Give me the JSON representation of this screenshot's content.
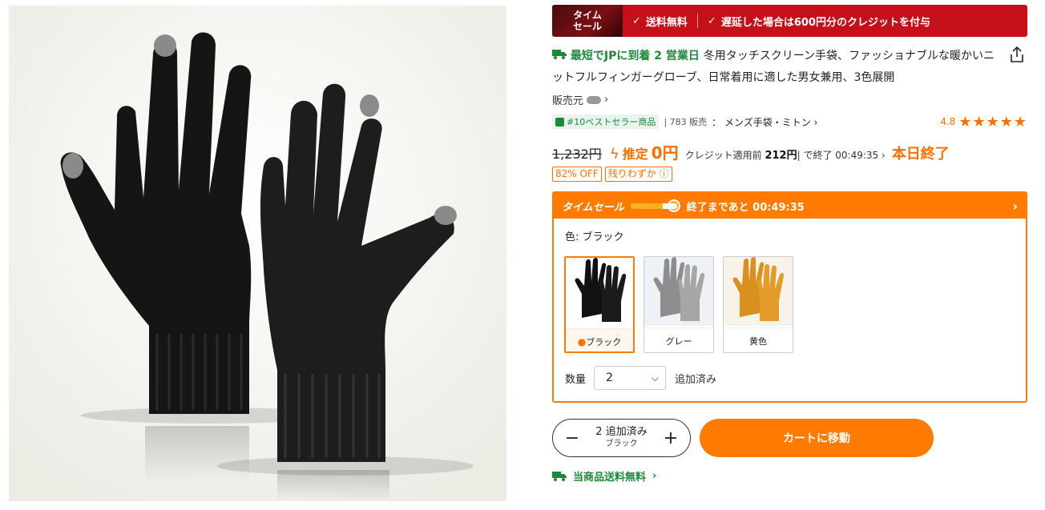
{
  "banner": {
    "label": "タイム\nセール",
    "free_ship": "送料無料",
    "credit": "遅延した場合は600円分のクレジットを付与"
  },
  "product": {
    "ship_label": "最短でJPに到着 2 営業日",
    "title": "冬用タッチスクリーン手袋、ファッショナブルな暖かいニットフルフィンガーグローブ、日常着用に適した男女兼用、3色展開",
    "seller_label": "販売元"
  },
  "best": {
    "badge": "#10ベストセラー商品",
    "sold": "783 販売",
    "category": "： メンズ手袋・ミトン"
  },
  "rating": {
    "value": "4.8",
    "stars": 5
  },
  "price": {
    "old": "1,232円",
    "est_label": "推定",
    "est_value": "0円",
    "credit_prefix": "クレジット適用前",
    "credit_value": "212円",
    "credit_suffix": "| で終了 00:49:35",
    "end_label": "本日終了",
    "off_badge": "82% OFF",
    "low_badge": "残りわずか"
  },
  "sale": {
    "label": "タイムセール",
    "countdown": "終了まであと 00:49:35",
    "progress": 0.7
  },
  "color": {
    "line": "色: ブラック",
    "options": [
      {
        "label": "ブラック",
        "selected": true
      },
      {
        "label": "グレー",
        "selected": false
      },
      {
        "label": "黄色",
        "selected": false
      }
    ]
  },
  "qty": {
    "label": "数量",
    "value": "2",
    "added": "追加済み"
  },
  "actions": {
    "stepper_main": "2 追加済み",
    "stepper_sub": "ブラック",
    "cart": "カートに移動"
  },
  "free_shipping": "当商品送料無料",
  "colors": {
    "accent": "#ff7a00",
    "green": "#1a8a3a",
    "banner": "#c5101a"
  }
}
